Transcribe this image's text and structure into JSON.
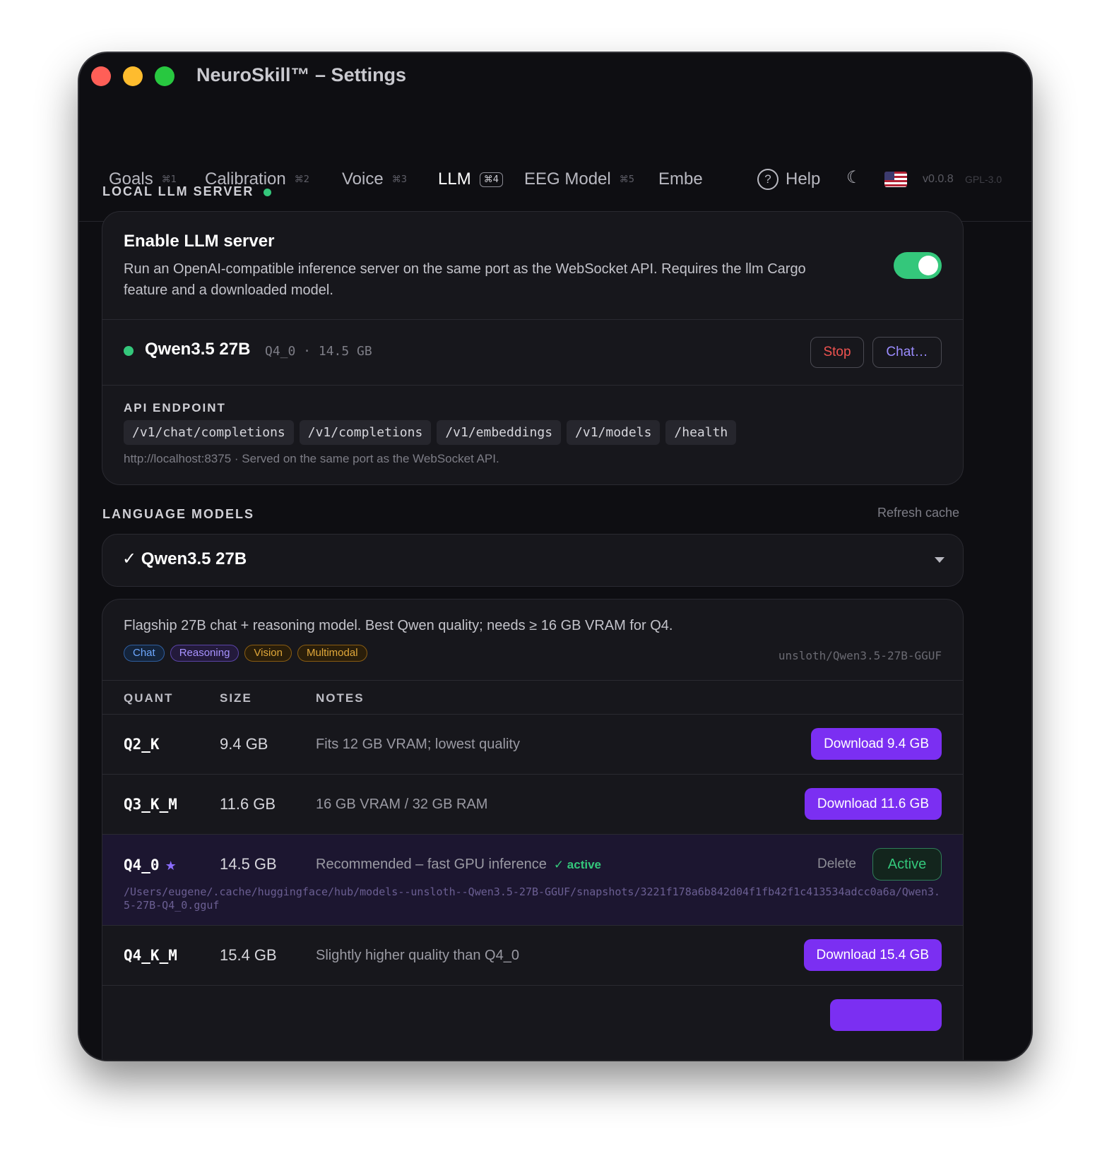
{
  "window": {
    "title": "NeuroSkill™ – Settings"
  },
  "tabs": [
    {
      "label": "Goals",
      "shortcut": "⌘1"
    },
    {
      "label": "Calibration",
      "shortcut": "⌘2"
    },
    {
      "label": "Voice",
      "shortcut": "⌘3"
    },
    {
      "label": "LLM",
      "shortcut": "⌘4"
    },
    {
      "label": "EEG Model",
      "shortcut": "⌘5"
    },
    {
      "label": "Embe"
    }
  ],
  "header": {
    "help_label": "Help",
    "help_icon": "?",
    "moon_icon": "☾",
    "version": "v0.0.8",
    "license": "GPL-3.0"
  },
  "server": {
    "section_label": "LOCAL LLM SERVER",
    "enable_title": "Enable LLM server",
    "enable_desc": "Run an OpenAI-compatible inference server on the same port as the WebSocket API. Requires the llm Cargo feature and a downloaded model.",
    "toggle_on": true,
    "model_name": "Qwen3.5 27B",
    "model_meta": "Q4_0 · 14.5 GB",
    "stop_label": "Stop",
    "chat_label": "Chat…",
    "api_label": "API ENDPOINT",
    "endpoints": [
      "/v1/chat/completions",
      "/v1/completions",
      "/v1/embeddings",
      "/v1/models",
      "/health"
    ],
    "api_hint": "http://localhost:8375 · Served on the same port as the WebSocket API."
  },
  "models": {
    "section_label": "LANGUAGE MODELS",
    "refresh_label": "Refresh cache",
    "selected": "✓ Qwen3.5 27B",
    "description": "Flagship 27B chat + reasoning model. Best Qwen quality; needs ≥ 16 GB VRAM for Q4.",
    "tags": [
      "Chat",
      "Reasoning",
      "Vision",
      "Multimodal"
    ],
    "repo": "unsloth/Qwen3.5-27B-GGUF",
    "columns": [
      "QUANT",
      "SIZE",
      "NOTES"
    ],
    "rows": [
      {
        "quant": "Q2_K",
        "size": "9.4 GB",
        "notes": "Fits 12 GB VRAM; lowest quality",
        "action": "Download 9.4 GB"
      },
      {
        "quant": "Q3_K_M",
        "size": "11.6 GB",
        "notes": "16 GB VRAM / 32 GB RAM",
        "action": "Download 11.6 GB"
      },
      {
        "quant": "Q4_0",
        "size": "14.5 GB",
        "notes": "Recommended – fast GPU inference",
        "active_mark": "✓ active",
        "star": "★",
        "delete_label": "Delete",
        "action": "Active",
        "path": "/Users/eugene/.cache/huggingface/hub/models--unsloth--Qwen3.5-27B-GGUF/snapshots/3221f178a6b842d04f1fb42f1c413534adcc0a6a/Qwen3.5-27B-Q4_0.gguf"
      },
      {
        "quant": "Q4_K_M",
        "size": "15.4 GB",
        "notes": "Slightly higher quality than Q4_0",
        "action": "Download 15.4 GB"
      }
    ]
  },
  "colors": {
    "accent": "#7b2ff2",
    "success": "#34c77b",
    "danger": "#ef5350",
    "background": "#0e0e12"
  }
}
